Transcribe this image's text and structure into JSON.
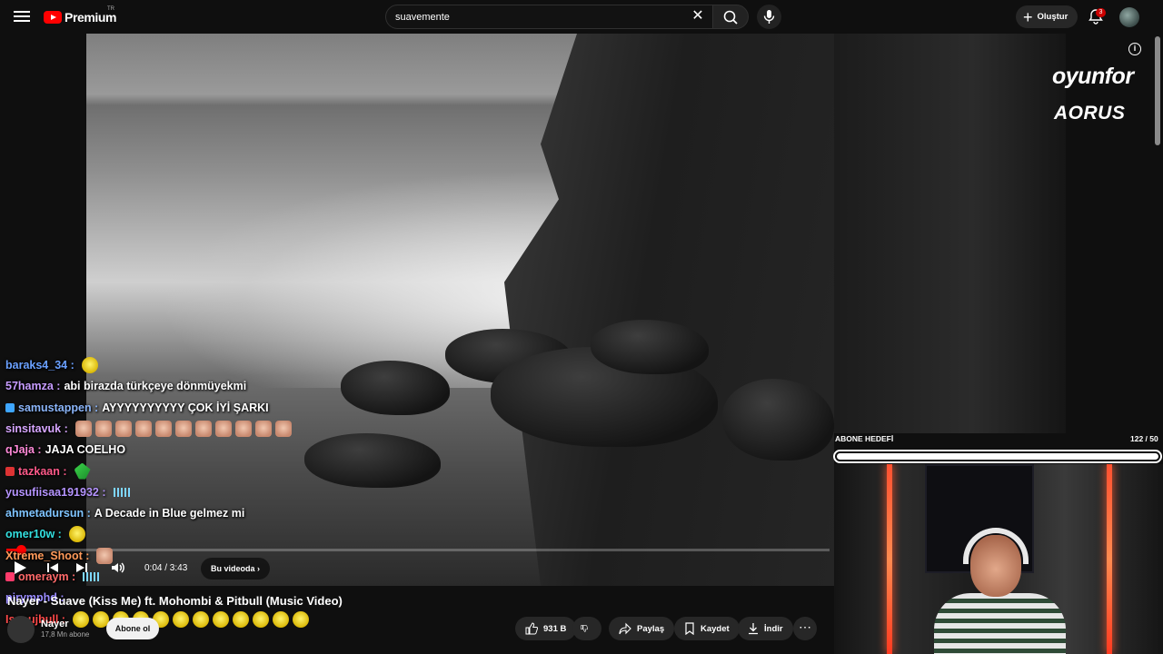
{
  "topbar": {
    "logo_text": "Premium",
    "logo_region": "TR",
    "search_value": "suavemente",
    "create_label": "Oluştur",
    "notification_count": "3"
  },
  "player": {
    "progress_fraction": 0.018,
    "time": "0:04 / 3:43",
    "chapter_label": "Bu videoda"
  },
  "chat": [
    {
      "user": "baraks4_34",
      "user_color": "#6aa0ff",
      "msg": "",
      "emotes": [
        "yellow"
      ]
    },
    {
      "user": "57hamza",
      "user_color": "#c79cff",
      "msg": "abi birazda türkçeye dönmüyekmi",
      "emotes": []
    },
    {
      "user": "samustappen",
      "user_color": "#8ab4f8",
      "msg": "AYYYYYYYYYY ÇOK İYİ ŞARKI",
      "emotes": [],
      "badge": "#3ea6ff"
    },
    {
      "user": "sinsitavuk",
      "user_color": "#d7a6ff",
      "msg": "",
      "emotes": [
        "face",
        "face",
        "face",
        "face",
        "face",
        "face",
        "face",
        "face",
        "face",
        "face",
        "face"
      ]
    },
    {
      "user": "qJaja",
      "user_color": "#ff8ad8",
      "msg": "JAJA COELHO",
      "emotes": []
    },
    {
      "user": "tazkaan",
      "user_color": "#ff5a8a",
      "msg": "",
      "emotes": [
        "green"
      ],
      "badge": "#d33"
    },
    {
      "user": "yusufiisaa191932",
      "user_color": "#b594ff",
      "msg": "",
      "emotes": [
        "bars"
      ]
    },
    {
      "user": "ahmetadursun",
      "user_color": "#7fc4ff",
      "msg": "A Decade in Blue gelmez mi",
      "emotes": []
    },
    {
      "user": "omer10w",
      "user_color": "#33e0e0",
      "msg": "",
      "emotes": [
        "yellow"
      ]
    },
    {
      "user": "Xtreme_Shoot",
      "user_color": "#ff9a5a",
      "msg": "",
      "emotes": [
        "face"
      ]
    },
    {
      "user": "omeraym",
      "user_color": "#ff6a6a",
      "msg": "",
      "emotes": [
        "bars"
      ],
      "badge": "#ff3b6b"
    },
    {
      "user": "pirymphd",
      "user_color": "#9a8cff",
      "msg": "",
      "emotes": []
    },
    {
      "user": "Issoujbull",
      "user_color": "#ff4a4a",
      "msg": "",
      "emotes": [
        "yellow",
        "yellow",
        "yellow",
        "yellow",
        "yellow",
        "yellow",
        "yellow",
        "yellow",
        "yellow",
        "yellow",
        "yellow",
        "yellow"
      ]
    }
  ],
  "video": {
    "title": "Nayer - Suave (Kiss Me) ft. Mohombi & Pitbull (Music Video)",
    "channel": "Nayer",
    "subscribers": "17,8 Mn abone",
    "subscribe_label": "Abone ol",
    "like_count": "931 B",
    "share_label": "Paylaş",
    "save_label": "Kaydet",
    "download_label": "İndir"
  },
  "overlay": {
    "brand_primary": "oyunfor",
    "brand_secondary": "AORUS",
    "goal_title": "ABONE HEDEFİ",
    "goal_count": "122 / 50",
    "goal_fraction": 1.0
  }
}
